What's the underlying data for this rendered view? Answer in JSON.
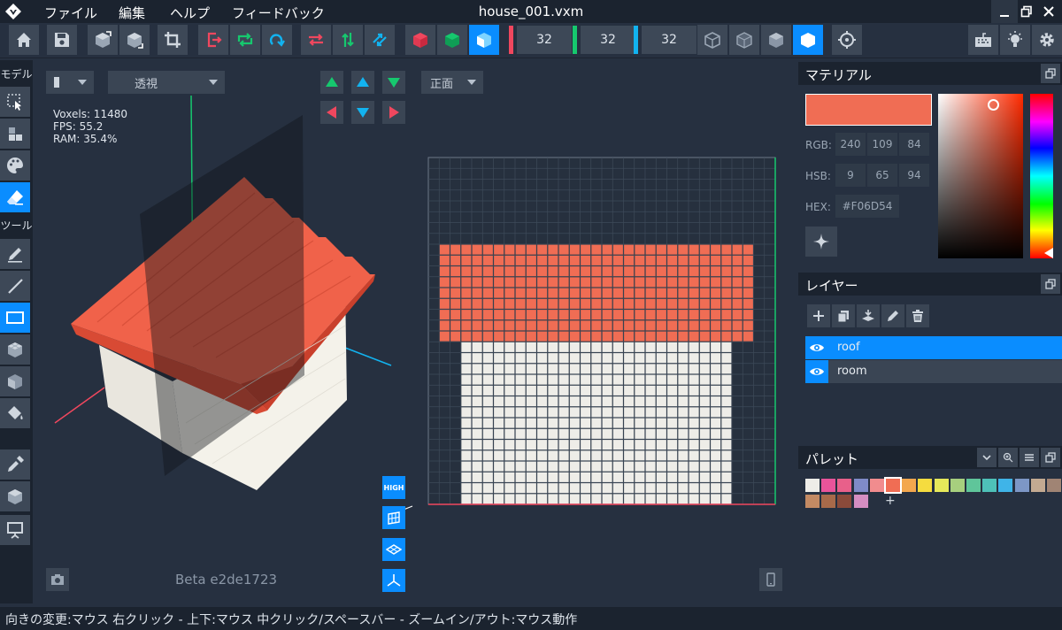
{
  "window": {
    "title": "house_001.vxm",
    "menu": [
      "ファイル",
      "編集",
      "ヘルプ",
      "フィードバック"
    ]
  },
  "toolbar": {
    "buttons": [
      "home-icon",
      "save-icon",
      "import-voxel-icon",
      "export-voxel-icon",
      "crop-icon",
      "exit-icon",
      "loop-icon",
      "redo-icon",
      "swap-x-icon",
      "swap-y-icon",
      "swap-z-icon",
      "cube-red-icon",
      "cube-green-icon",
      "cube-blue-icon"
    ],
    "dims": [
      {
        "value": "32",
        "color": "#f0475e"
      },
      {
        "value": "32",
        "color": "#16c86e"
      },
      {
        "value": "32",
        "color": "#12b3f0"
      }
    ],
    "render_modes": [
      "wire-cube-icon",
      "outline-cube-icon",
      "shaded-cube-icon",
      "solid-cube-icon"
    ],
    "active_render_mode": "solid-cube-icon"
  },
  "sidebar": {
    "model_label": "モデル",
    "tool_label": "ツール"
  },
  "viewport": {
    "view_mode_select": "透視",
    "face_select": "正面",
    "stats": [
      "Voxels: 11480",
      "FPS: 55.2",
      "RAM: 35.4%"
    ],
    "quality_button": "HIGH",
    "version": "Beta e2de1723"
  },
  "material": {
    "title": "マテリアル",
    "color": "#f06d54",
    "rgb_label": "RGB:",
    "rgb": [
      "240",
      "109",
      "84"
    ],
    "hsb_label": "HSB:",
    "hsb": [
      "9",
      "65",
      "94"
    ],
    "hex_label": "HEX:",
    "hex": "#F06D54"
  },
  "layers": {
    "title": "レイヤー",
    "items": [
      {
        "name": "roof",
        "selected": true
      },
      {
        "name": "room",
        "selected": false
      }
    ]
  },
  "palette": {
    "title": "パレット",
    "colors": [
      "#eeede8",
      "#e9549a",
      "#e8608a",
      "#7f8bc8",
      "#f18c8e",
      "#f06d54",
      "#f3a74e",
      "#f5dc3f",
      "#e6e85a",
      "#a7cf7e",
      "#5fc59a",
      "#4ec1b8",
      "#3fb4e8",
      "#7d97c6",
      "#c3aa92",
      "#a08474",
      "#7a5a48",
      "#c38a63",
      "#a86a4a",
      "#8a4a3a",
      "#d58ec2"
    ],
    "selected_color": "#f06d54"
  },
  "status": {
    "text": "向きの変更:マウス 右クリック - 上下:マウス 中クリック/スペースバー - ズームイン/アウト:マウス動作"
  }
}
